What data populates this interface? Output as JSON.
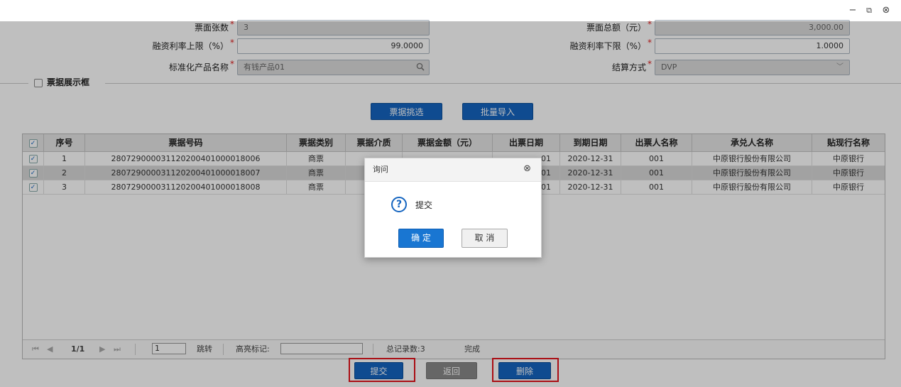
{
  "window": {
    "minimize": "−",
    "restore": "⧉",
    "close": "⊗"
  },
  "form": {
    "ticket_count_label": "票面张数",
    "ticket_count_value": "3",
    "total_amount_label": "票面总额（元）",
    "total_amount_value": "3,000.00",
    "rate_upper_label": "融资利率上限（%）",
    "rate_upper_value": "99.0000",
    "rate_lower_label": "融资利率下限（%）",
    "rate_lower_value": "1.0000",
    "product_label": "标准化产品名称",
    "product_value": "有钱产品01",
    "settlement_label": "结算方式",
    "settlement_value": "DVP",
    "required_mark": "*"
  },
  "section": {
    "title": "票据展示框"
  },
  "actions": {
    "select_label": "票据挑选",
    "import_label": "批量导入"
  },
  "table": {
    "columns": [
      "序号",
      "票据号码",
      "票据类别",
      "票据介质",
      "票据金额（元）",
      "出票日期",
      "到期日期",
      "出票人名称",
      "承兑人名称",
      "贴现行名称"
    ],
    "rows": [
      {
        "no": "1",
        "bill_no": "280729000031120200401000018006",
        "type": "商票",
        "issue": "01",
        "due": "2020-12-31",
        "drawer": "001",
        "acceptor": "中原银行股份有限公司",
        "bank": "中原银行"
      },
      {
        "no": "2",
        "bill_no": "280729000031120200401000018007",
        "type": "商票",
        "issue": "01",
        "due": "2020-12-31",
        "drawer": "001",
        "acceptor": "中原银行股份有限公司",
        "bank": "中原银行"
      },
      {
        "no": "3",
        "bill_no": "280729000031120200401000018008",
        "type": "商票",
        "issue": "01",
        "due": "2020-12-31",
        "drawer": "001",
        "acceptor": "中原银行股份有限公司",
        "bank": "中原银行"
      }
    ]
  },
  "pager": {
    "first": "⏮",
    "prev": "◀",
    "page_info": "1/1",
    "next": "▶",
    "last": "⏭",
    "page_input": "1",
    "jump_label": "跳转",
    "highlight_label": "高亮标记:",
    "total_label": "总记录数:3",
    "status": "完成"
  },
  "bottom": {
    "submit_label": "提交",
    "back_label": "返回",
    "delete_label": "删除"
  },
  "dialog": {
    "title": "询问",
    "close": "⊗",
    "icon": "?",
    "message": "提交",
    "ok_label": "确 定",
    "cancel_label": "取 消"
  },
  "colors": {
    "primary": "#1565c0",
    "highlight_red": "#e3131b",
    "required_red": "#e02020"
  }
}
